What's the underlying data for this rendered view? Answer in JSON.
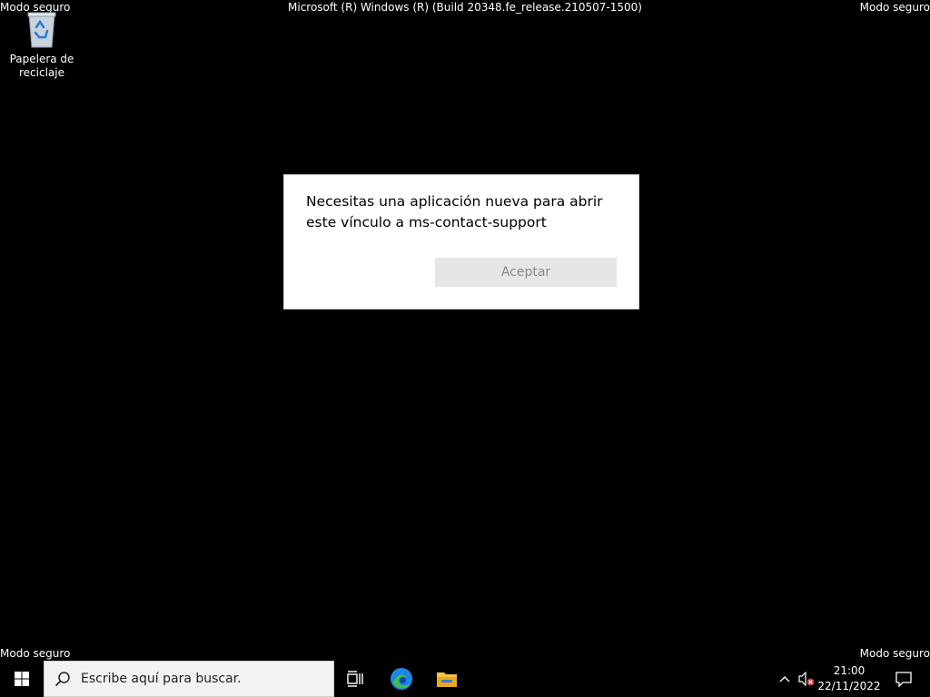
{
  "overlay": {
    "top_left": "Modo seguro",
    "top_center": "Microsoft (R) Windows (R) (Build 20348.fe_release.210507-1500)",
    "top_right": "Modo seguro",
    "bottom_left": "Modo seguro",
    "bottom_right": "Modo seguro"
  },
  "desktop": {
    "recycle_bin_label": "Papelera de reciclaje",
    "recycle_bin_icon": "recycle-bin-icon"
  },
  "dialog": {
    "message": "Necesitas una aplicación nueva para abrir este vínculo a ms-contact-support",
    "accept_label": "Aceptar"
  },
  "taskbar": {
    "start_icon": "windows-logo-icon",
    "search_placeholder": "Escribe aquí para buscar.",
    "task_view_icon": "task-view-icon",
    "edge_icon": "edge-icon",
    "file_explorer_icon": "folder-icon",
    "tray": {
      "chevron_icon": "chevron-up-icon",
      "volume_icon": "speaker-muted-icon",
      "time": "21:00",
      "date": "22/11/2022",
      "notifications_icon": "action-center-icon"
    }
  },
  "colors": {
    "background": "#000000",
    "dialog_bg": "#ffffff",
    "button_bg": "#e6e6e6",
    "edge_blue": "#1e88e5",
    "edge_green": "#3cc14b",
    "folder_yellow": "#f5c542"
  }
}
